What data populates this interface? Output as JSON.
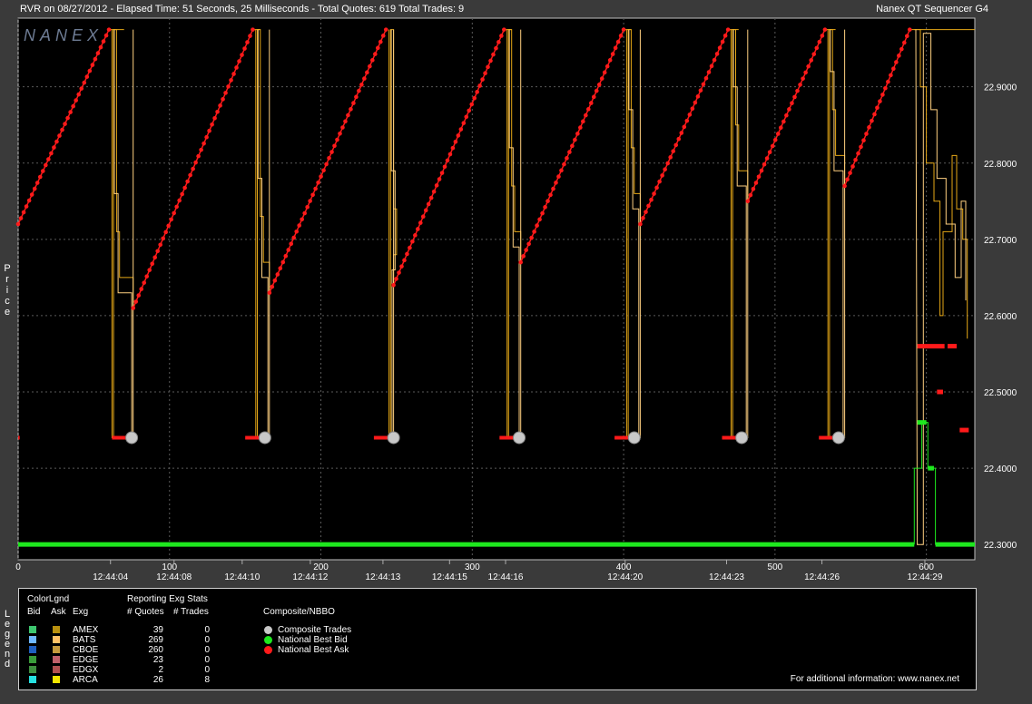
{
  "header": {
    "title_left": "RVR on 08/27/2012  -  Elapsed Time: 51 Seconds, 25 Milliseconds  -  Total Quotes: 619  Total Trades: 9",
    "title_right": "Nanex QT Sequencer G4"
  },
  "watermark": "NANEX",
  "side_labels": {
    "price": "Price",
    "legend": "Legend"
  },
  "colors": {
    "background": "#000000",
    "ask_lines": "#e6a817",
    "ask_lines_light": "#ffd080",
    "nbbo_ask": "#ff1a1a",
    "nbbo_bid": "#1ee81e",
    "trade": "#c8c8c8",
    "grid": "#5a5a5a"
  },
  "chart_data": {
    "type": "line",
    "title": "RVR on 08/27/2012",
    "ylabel": "Price",
    "ylim": [
      22.28,
      22.99
    ],
    "xlim": [
      0,
      632
    ],
    "y_ticks": [
      "22.3000",
      "22.4000",
      "22.5000",
      "22.6000",
      "22.7000",
      "22.8000",
      "22.9000"
    ],
    "y_tick_values": [
      22.3,
      22.4,
      22.5,
      22.6,
      22.7,
      22.8,
      22.9
    ],
    "x_ticks": [
      "0",
      "100",
      "200",
      "300",
      "400",
      "500",
      "600"
    ],
    "x_tick_values": [
      0,
      100,
      200,
      300,
      400,
      500,
      600
    ],
    "time_ticks": [
      {
        "x": 61,
        "label": "12:44:04"
      },
      {
        "x": 103,
        "label": "12:44:08"
      },
      {
        "x": 148,
        "label": "12:44:10"
      },
      {
        "x": 193,
        "label": "12:44:12"
      },
      {
        "x": 241,
        "label": "12:44:13"
      },
      {
        "x": 285,
        "label": "12:44:15"
      },
      {
        "x": 322,
        "label": "12:44:16"
      },
      {
        "x": 401,
        "label": "12:44:20"
      },
      {
        "x": 468,
        "label": "12:44:23"
      },
      {
        "x": 531,
        "label": "12:44:26"
      },
      {
        "x": 599,
        "label": "12:44:29"
      }
    ],
    "ramps": [
      {
        "x_start": 0,
        "y_start": 22.72,
        "x_end": 60,
        "y_end": 22.975
      },
      {
        "x_start": 76,
        "y_start": 22.61,
        "x_end": 155,
        "y_end": 22.975
      },
      {
        "x_start": 166,
        "y_start": 22.63,
        "x_end": 243,
        "y_end": 22.975
      },
      {
        "x_start": 248,
        "y_start": 22.64,
        "x_end": 321,
        "y_end": 22.975
      },
      {
        "x_start": 332,
        "y_start": 22.67,
        "x_end": 400,
        "y_end": 22.975
      },
      {
        "x_start": 411,
        "y_start": 22.72,
        "x_end": 469,
        "y_end": 22.975
      },
      {
        "x_start": 482,
        "y_start": 22.75,
        "x_end": 533,
        "y_end": 22.975
      },
      {
        "x_start": 546,
        "y_start": 22.77,
        "x_end": 589,
        "y_end": 22.975
      }
    ],
    "trades": [
      {
        "x": 75,
        "y": 22.44
      },
      {
        "x": 163,
        "y": 22.44
      },
      {
        "x": 248,
        "y": 22.44
      },
      {
        "x": 331,
        "y": 22.44
      },
      {
        "x": 407,
        "y": 22.44
      },
      {
        "x": 478,
        "y": 22.44
      },
      {
        "x": 542,
        "y": 22.44
      }
    ],
    "nbbo_bid_level": 22.3,
    "series": [
      {
        "name": "Composite Trades"
      },
      {
        "name": "National Best Bid"
      },
      {
        "name": "National Best Ask"
      }
    ]
  },
  "legend": {
    "colorlegend_title": "ColorLgnd",
    "bid_header": "Bid",
    "ask_header": "Ask",
    "exg_header": "Exg",
    "stats_title": "Reporting Exg Stats",
    "quotes_header": "# Quotes",
    "trades_header": "# Trades",
    "composite_title": "Composite/NBBO",
    "composite_items": [
      "Composite Trades",
      "National Best Bid",
      "National Best Ask"
    ],
    "exchanges": [
      {
        "name": "AMEX",
        "quotes": "39",
        "trades": "0",
        "bid_color": "#3ec76f",
        "ask_color": "#b8900f"
      },
      {
        "name": "BATS",
        "quotes": "269",
        "trades": "0",
        "bid_color": "#6fb8ff",
        "ask_color": "#ffc266"
      },
      {
        "name": "CBOE",
        "quotes": "260",
        "trades": "0",
        "bid_color": "#1f5fbf",
        "ask_color": "#c49a3c"
      },
      {
        "name": "EDGE",
        "quotes": "23",
        "trades": "0",
        "bid_color": "#3a9c3a",
        "ask_color": "#c0606a"
      },
      {
        "name": "EDGX",
        "quotes": "2",
        "trades": "0",
        "bid_color": "#3f8f3f",
        "ask_color": "#b05050"
      },
      {
        "name": "ARCA",
        "quotes": "26",
        "trades": "8",
        "bid_color": "#26e0e0",
        "ask_color": "#f4e600"
      }
    ],
    "footer": "For additional information: www.nanex.net"
  }
}
